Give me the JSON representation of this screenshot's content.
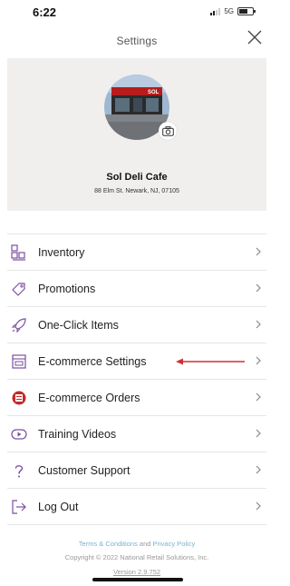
{
  "status_bar": {
    "time": "6:22",
    "network": "5G"
  },
  "header": {
    "title": "Settings",
    "close_icon": "close-icon"
  },
  "profile": {
    "name": "Sol Deli Cafe",
    "address": "88 Elm St. Newark, NJ, 07105",
    "camera_icon": "camera-icon"
  },
  "menu": [
    {
      "label": "Inventory",
      "icon": "inventory-icon"
    },
    {
      "label": "Promotions",
      "icon": "tag-icon"
    },
    {
      "label": "One-Click Items",
      "icon": "rocket-icon"
    },
    {
      "label": "E-commerce Settings",
      "icon": "storefront-icon"
    },
    {
      "label": "E-commerce Orders",
      "icon": "orders-icon"
    },
    {
      "label": "Training Videos",
      "icon": "play-icon"
    },
    {
      "label": "Customer Support",
      "icon": "question-icon"
    },
    {
      "label": "Log Out",
      "icon": "logout-icon"
    }
  ],
  "footer": {
    "terms": "Terms & Conditions",
    "and": "and",
    "privacy": "Privacy Policy",
    "copyright": "Copyright © 2022 National Retail Solutions, Inc.",
    "version": "Version 2.9.752"
  },
  "colors": {
    "annotation_arrow": "#d32f2f",
    "link": "#7ab3cf",
    "profile_bg": "#f0efee",
    "orders_icon": "#c62828"
  }
}
